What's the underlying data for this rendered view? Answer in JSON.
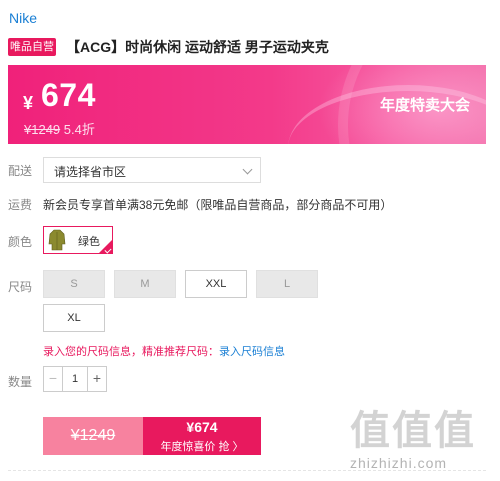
{
  "brand": "Nike",
  "product": {
    "self_tag": "唯品自营",
    "title": "【ACG】时尚休闲 运动舒适 男子运动夹克"
  },
  "banner": {
    "currency": "¥",
    "price": "674",
    "original_price": "¥1249",
    "discount": "5.4折",
    "event": "年度特卖大会",
    "colors": {
      "start": "#f0217a",
      "end": "#f36aa8"
    }
  },
  "shipping": {
    "label": "配送",
    "select_value": "请选择省市区"
  },
  "freight": {
    "label": "运费",
    "text": "新会员专享首单满38元免邮（限唯品自营商品，部分商品不可用）"
  },
  "color_option": {
    "label": "颜色",
    "selected": "绿色",
    "icon": "jacket-thumbnail"
  },
  "sizes": {
    "label": "尺码",
    "items": [
      {
        "label": "S",
        "available": false
      },
      {
        "label": "M",
        "available": false
      },
      {
        "label": "XXL",
        "available": true
      },
      {
        "label": "L",
        "available": false
      },
      {
        "label": "XL",
        "available": true
      }
    ],
    "hint": "录入您的尺码信息，精准推荐尺码：",
    "hint_link": "录入尺码信息"
  },
  "quantity": {
    "label": "数量",
    "minus": "−",
    "value": "1",
    "plus": "+"
  },
  "actions": {
    "original_price": "¥1249",
    "buy_price": "¥674",
    "buy_label": "年度惊喜价 抢 〉"
  },
  "watermark": {
    "glyphs": "值值值",
    "url": "zhizhizhi.com"
  },
  "accent_color": "#e8195e",
  "link_color": "#1a7fd4"
}
